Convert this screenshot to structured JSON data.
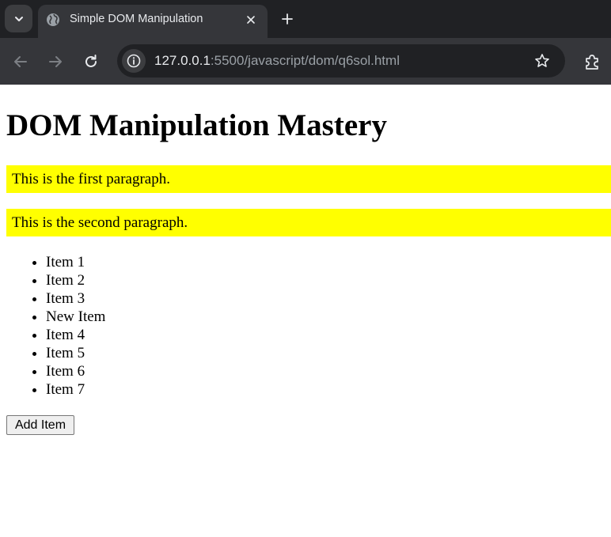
{
  "browser": {
    "tab": {
      "title": "Simple DOM Manipulation"
    },
    "address_bar": {
      "host": "127.0.0.1",
      "path": ":5500/javascript/dom/q6sol.html"
    }
  },
  "page": {
    "heading": "DOM Manipulation Mastery",
    "paragraphs": [
      "This is the first paragraph.",
      "This is the second paragraph."
    ],
    "list_items": [
      "Item 1",
      "Item 2",
      "Item 3",
      "New Item",
      "Item 4",
      "Item 5",
      "Item 6",
      "Item 7"
    ],
    "add_button_label": "Add Item"
  },
  "colors": {
    "paragraph_highlight": "#ffff00",
    "tabstrip_bg": "#202124",
    "toolbar_bg": "#35363a"
  },
  "icons": {
    "tab_search": "chevron-down-icon",
    "favicon": "globe-icon",
    "tab_close": "close-icon",
    "new_tab": "plus-icon",
    "back": "arrow-left-icon",
    "forward": "arrow-right-icon",
    "reload": "reload-icon",
    "site_info": "info-icon",
    "bookmark": "star-icon",
    "extensions": "puzzle-icon"
  }
}
